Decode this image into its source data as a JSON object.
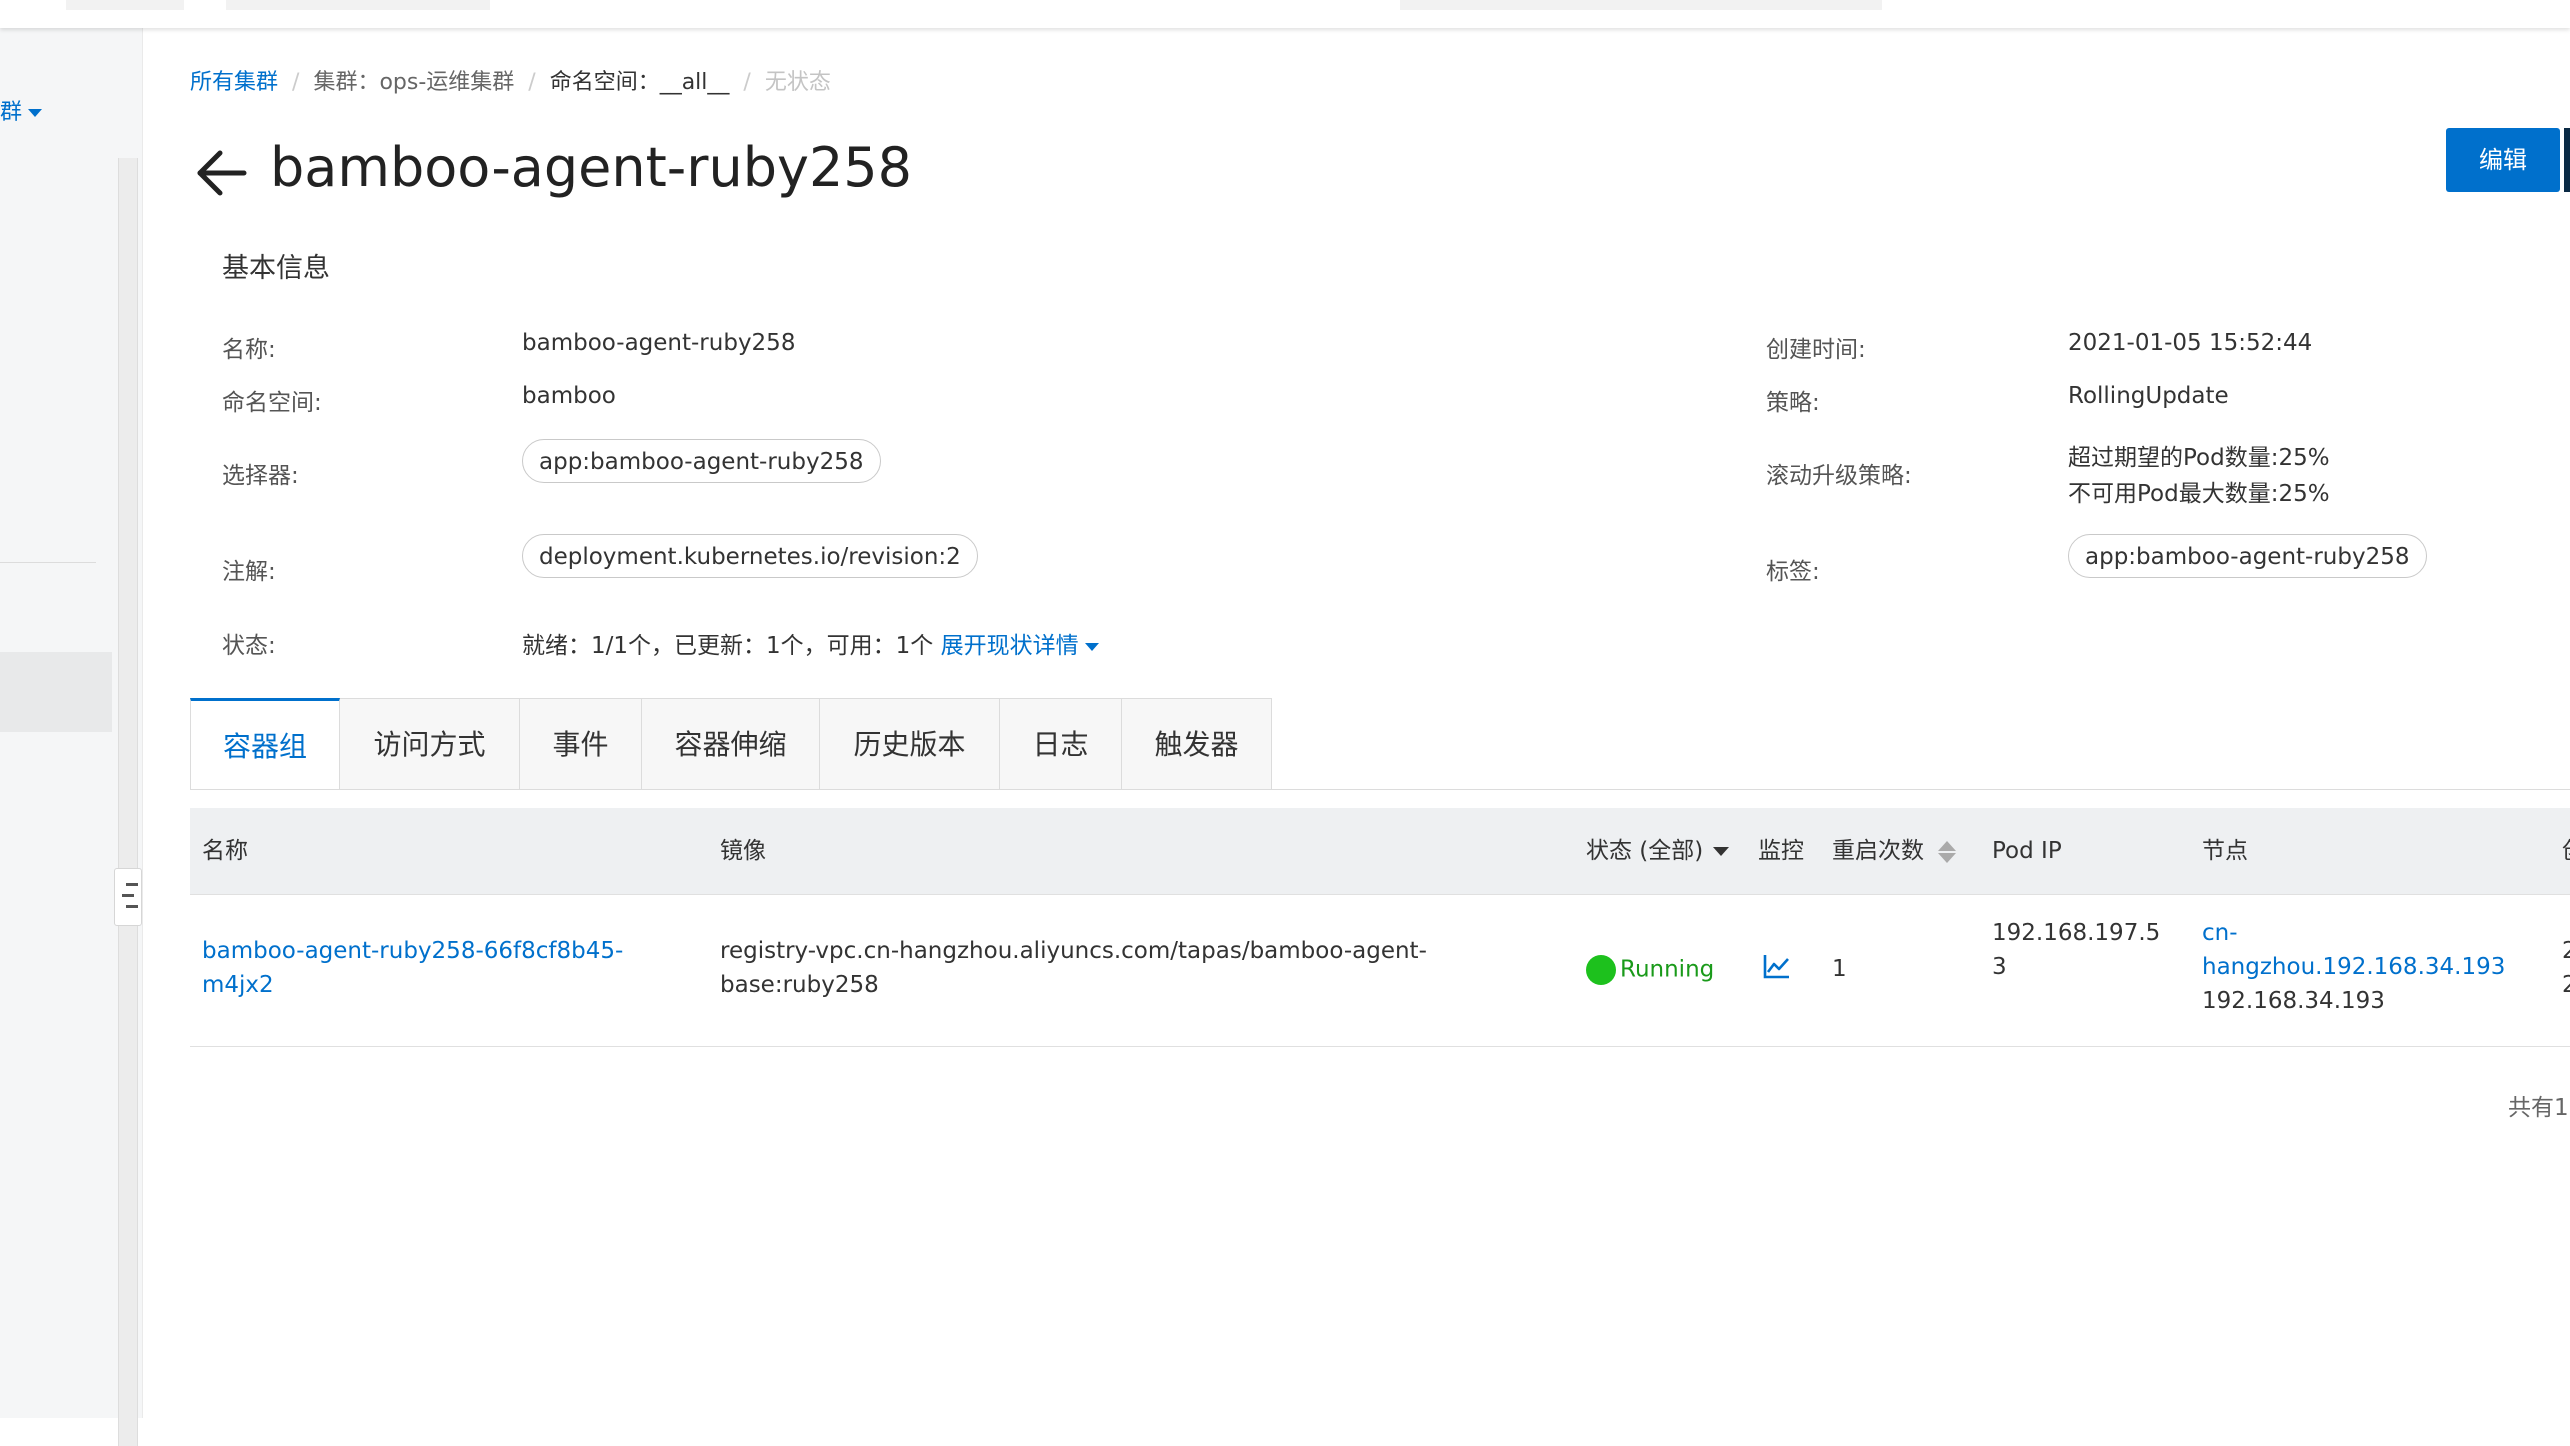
{
  "left": {
    "cluster_fragment": "群"
  },
  "breadcrumb": {
    "all_clusters": "所有集群",
    "cluster": "集群：ops-运维集群",
    "namespace": "命名空间：__all__",
    "current": "无状态"
  },
  "header": {
    "title": "bamboo-agent-ruby258",
    "edit_label": "编辑"
  },
  "basic_info": {
    "title": "基本信息",
    "name_label": "名称:",
    "name_value": "bamboo-agent-ruby258",
    "namespace_label": "命名空间:",
    "namespace_value": "bamboo",
    "selector_label": "选择器:",
    "selector_value": "app:bamboo-agent-ruby258",
    "annotation_label": "注解:",
    "annotation_value": "deployment.kubernetes.io/revision:2",
    "status_label": "状态:",
    "status_value": "就绪：1/1个，已更新：1个，可用：1个",
    "status_expand": "展开现状详情",
    "created_label": "创建时间:",
    "created_value": "2021-01-05 15:52:44",
    "strategy_label": "策略:",
    "strategy_value": "RollingUpdate",
    "rolling_label": "滚动升级策略:",
    "rolling_line1": "超过期望的Pod数量:25%",
    "rolling_line2": "不可用Pod最大数量:25%",
    "labels_label": "标签:",
    "labels_value": "app:bamboo-agent-ruby258"
  },
  "tabs": [
    "容器组",
    "访问方式",
    "事件",
    "容器伸缩",
    "历史版本",
    "日志",
    "触发器"
  ],
  "table": {
    "headers": {
      "name": "名称",
      "image": "镜像",
      "status": "状态 (全部)",
      "monitor": "监控",
      "restarts": "重启次数",
      "pod_ip": "Pod IP",
      "node": "节点",
      "created_fragment": "创"
    },
    "rows": [
      {
        "name_line1": "bamboo-agent-ruby258-66f8cf8b45-",
        "name_line2": "m4jx2",
        "image_line1": "registry-vpc.cn-hangzhou.aliyuncs.com/tapas/bamboo-agent-",
        "image_line2": "base:ruby258",
        "status": "Running",
        "restarts": "1",
        "pod_ip_line1": "192.168.197.5",
        "pod_ip_line2": "3",
        "node_line1": "cn-",
        "node_line2": "hangzhou.192.168.34.193",
        "node_line3": "192.168.34.193",
        "created_line1": "2",
        "created_line2": "2"
      }
    ]
  },
  "pager": {
    "total_text": "共有1"
  },
  "colors": {
    "primary": "#0070cc",
    "running_green": "#1dc11d"
  }
}
